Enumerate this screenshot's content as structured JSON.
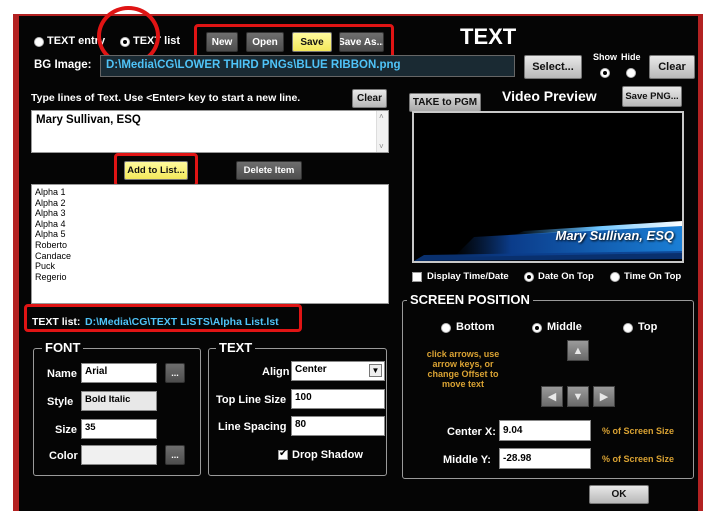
{
  "top": {
    "radio_text_entry": "TEXT entry",
    "radio_text_list": "TEXT list",
    "new_label": "New",
    "open_label": "Open",
    "save_label": "Save",
    "save_as_label": "Save As...",
    "heading": "TEXT",
    "show_label": "Show",
    "hide_label": "Hide"
  },
  "bg_image": {
    "label": "BG Image:",
    "path": "D:\\Media\\CG\\LOWER THIRD PNGs\\BLUE RIBBON.png",
    "select_label": "Select...",
    "clear_label": "Clear"
  },
  "text_entry": {
    "instruction": "Type lines of Text.  Use <Enter> key to start a new line.",
    "clear_label": "Clear",
    "value": "Mary Sullivan, ESQ",
    "add_label": "Add to List...",
    "delete_label": "Delete Item"
  },
  "list": {
    "items": [
      "Alpha 1",
      "Alpha 2",
      "Alpha 3",
      "Alpha 4",
      "Alpha 5",
      "Roberto",
      "Candace",
      "Puck",
      "Regerio"
    ],
    "file_label": "TEXT list:",
    "file_path": "D:\\Media\\CG\\TEXT LISTS\\Alpha List.lst"
  },
  "preview": {
    "take_label": "TAKE to PGM",
    "title": "Video Preview",
    "save_png_label": "Save PNG...",
    "lower_third_text": "Mary Sullivan, ESQ",
    "display_time_label": "Display Time/Date",
    "date_on_top_label": "Date On Top",
    "time_on_top_label": "Time On Top"
  },
  "font": {
    "title": "FONT",
    "name_label": "Name",
    "name_value": "Arial",
    "style_label": "Style",
    "style_value": "Bold Italic",
    "size_label": "Size",
    "size_value": "35",
    "color_label": "Color",
    "browse_label": "..."
  },
  "text_group": {
    "title": "TEXT",
    "align_label": "Align",
    "align_value": "Center",
    "top_line_size_label": "Top Line Size",
    "top_line_size_value": "100",
    "line_spacing_label": "Line Spacing",
    "line_spacing_value": "80",
    "drop_shadow_label": "Drop Shadow"
  },
  "screen_position": {
    "title": "SCREEN POSITION",
    "bottom_label": "Bottom",
    "middle_label": "Middle",
    "top_label": "Top",
    "hint": "click arrows, use arrow keys, or change Offset to move text",
    "center_x_label": "Center X:",
    "center_x_value": "9.04",
    "middle_y_label": "Middle Y:",
    "middle_y_value": "-28.98",
    "percent_label": "% of Screen Size",
    "ok_label": "OK"
  },
  "colors": {
    "frame_red": "#b32222",
    "highlight_red": "#e01414",
    "path_blue": "#4fc3f7",
    "hint_orange": "#d9a233",
    "button_yellow": "#fffb9e"
  }
}
